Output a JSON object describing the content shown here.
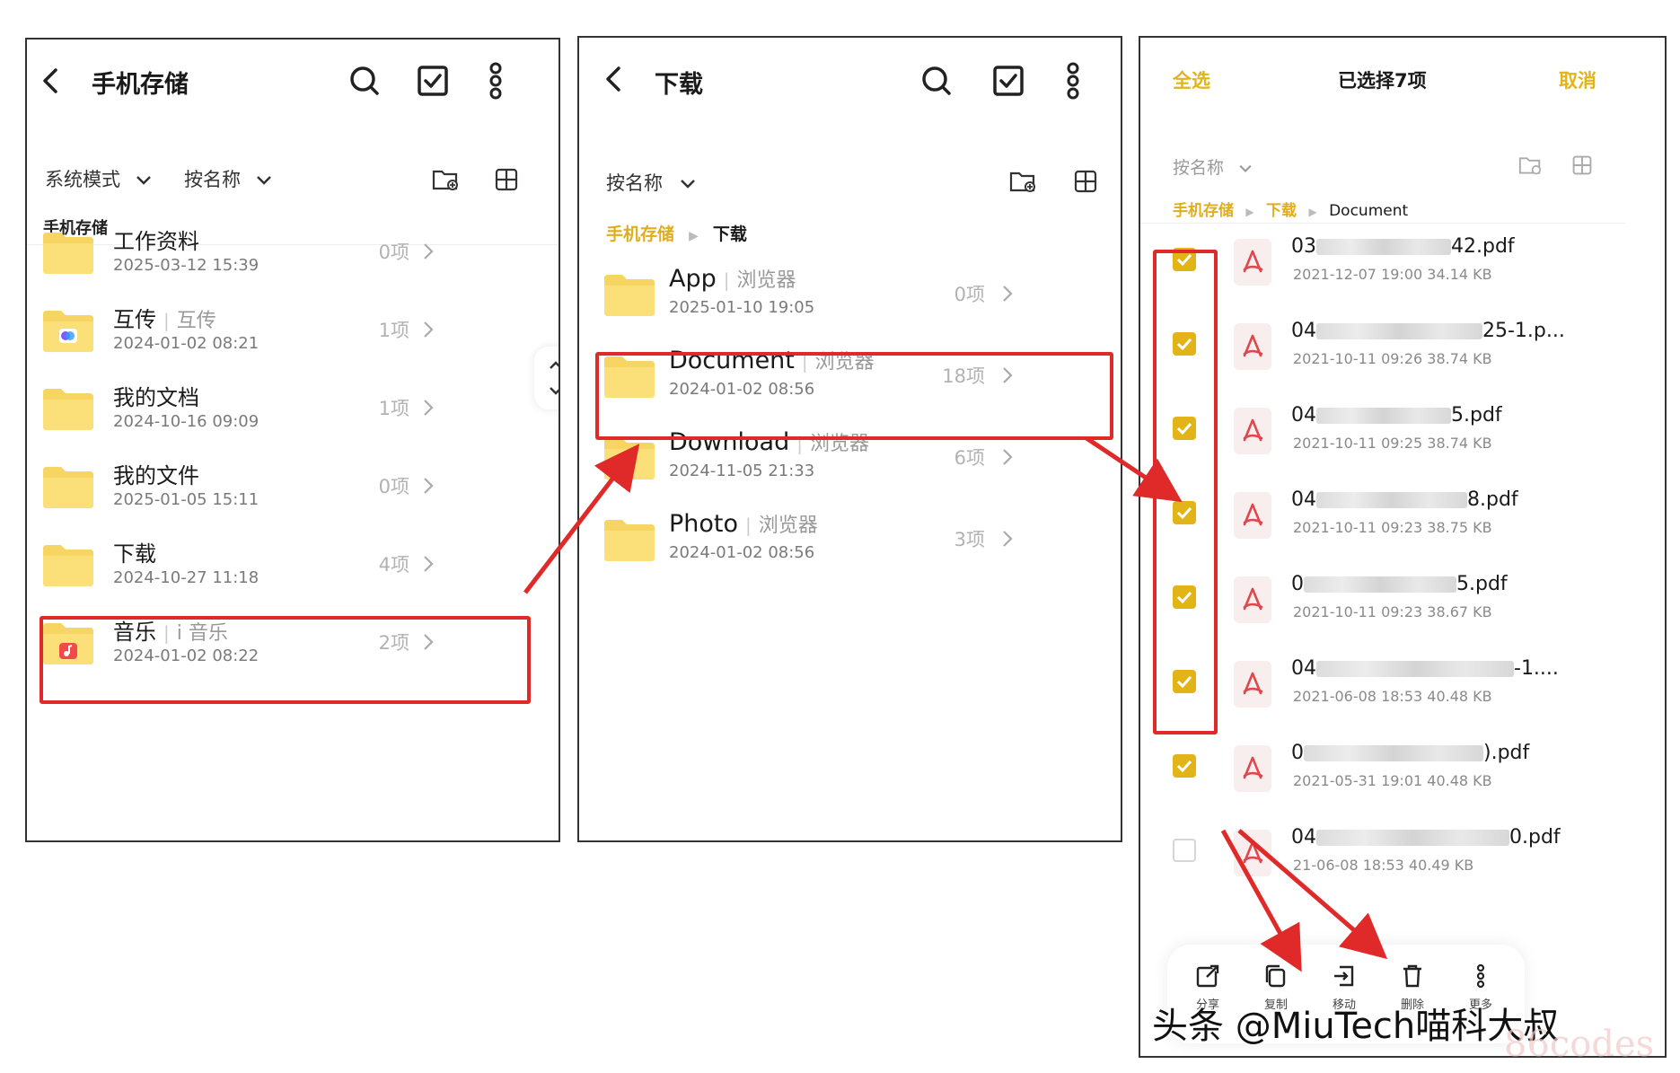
{
  "colors": {
    "accent": "#e2b417",
    "highlight": "#e02a2a",
    "folder": "#f7d563",
    "pdf_icon": "#e0474c"
  },
  "panel1": {
    "title": "手机存储",
    "mode_label": "系统模式",
    "sort_label": "按名称",
    "section_label": "手机存储",
    "icons": [
      "back-icon",
      "search-icon",
      "select-icon",
      "more-icon",
      "new-folder-icon",
      "grid-view-icon"
    ],
    "folders": [
      {
        "name": "工作资料",
        "source": "",
        "date": "2025-03-12 15:39",
        "count": "0项",
        "badge": ""
      },
      {
        "name": "互传",
        "source": "互传",
        "date": "2024-01-02 08:21",
        "count": "1项",
        "badge": "share"
      },
      {
        "name": "我的文档",
        "source": "",
        "date": "2024-10-16 09:09",
        "count": "1项",
        "badge": ""
      },
      {
        "name": "我的文件",
        "source": "",
        "date": "2025-01-05 15:11",
        "count": "0项",
        "badge": ""
      },
      {
        "name": "下载",
        "source": "",
        "date": "2024-10-27 11:18",
        "count": "4项",
        "badge": ""
      },
      {
        "name": "音乐",
        "source": "i 音乐",
        "date": "2024-01-02 08:22",
        "count": "2项",
        "badge": "music"
      }
    ]
  },
  "panel2": {
    "title": "下载",
    "sort_label": "按名称",
    "breadcrumb": [
      "手机存储",
      "下载"
    ],
    "folders": [
      {
        "name": "App",
        "source": "浏览器",
        "date": "2025-01-10 19:05",
        "count": "0项"
      },
      {
        "name": "Document",
        "source": "浏览器",
        "date": "2024-01-02 08:56",
        "count": "18项"
      },
      {
        "name": "Download",
        "source": "浏览器",
        "date": "2024-11-05 21:33",
        "count": "6项"
      },
      {
        "name": "Photo",
        "source": "浏览器",
        "date": "2024-01-02 08:56",
        "count": "3项"
      }
    ]
  },
  "panel3": {
    "select_all": "全选",
    "selection_title": "已选择7项",
    "cancel": "取消",
    "sort_label": "按名称",
    "breadcrumb": [
      "手机存储",
      "下载",
      "Document"
    ],
    "files": [
      {
        "prefix": "03",
        "suffix": "42.pdf",
        "meta": "2021-12-07 19:00   34.14 KB",
        "checked": true
      },
      {
        "prefix": "04",
        "suffix": "25-1.p...",
        "meta": "2021-10-11 09:26   38.74 KB",
        "checked": true
      },
      {
        "prefix": "04",
        "suffix": "5.pdf",
        "meta": "2021-10-11 09:25   38.74 KB",
        "checked": true
      },
      {
        "prefix": "04",
        "suffix": "8.pdf",
        "meta": "2021-10-11 09:23   38.75 KB",
        "checked": true
      },
      {
        "prefix": "0",
        "suffix": "5.pdf",
        "meta": "2021-10-11 09:23   38.67 KB",
        "checked": true
      },
      {
        "prefix": "04",
        "suffix": "-1....",
        "meta": "2021-06-08 18:53   40.48 KB",
        "checked": true
      },
      {
        "prefix": "0",
        "suffix": ").pdf",
        "meta": "2021-05-31 19:01   40.48 KB",
        "checked": true
      },
      {
        "prefix": "04",
        "suffix": "0.pdf",
        "meta": "21-06-08 18:53   40.49 KB",
        "checked": false
      }
    ],
    "toolbar": [
      {
        "icon": "share-icon",
        "label": "分享"
      },
      {
        "icon": "copy-icon",
        "label": "复制"
      },
      {
        "icon": "move-icon",
        "label": "移动"
      },
      {
        "icon": "delete-icon",
        "label": "删除"
      },
      {
        "icon": "more-icon",
        "label": "更多"
      }
    ]
  },
  "watermark": "头条 @MiuTech喵科大叔",
  "watermark2": "86codes"
}
